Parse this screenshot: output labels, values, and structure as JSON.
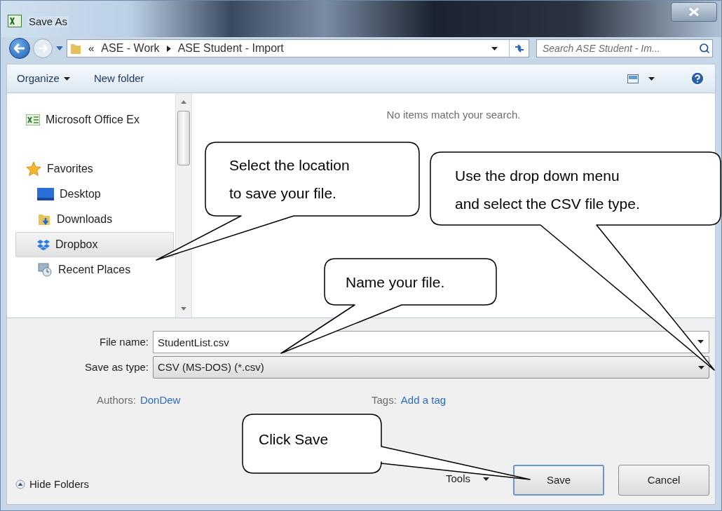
{
  "window": {
    "title": "Save As"
  },
  "address": {
    "overflow": "«",
    "breadcrumb": [
      "ASE - Work",
      "ASE Student - Import"
    ]
  },
  "search": {
    "placeholder": "Search ASE Student - Im..."
  },
  "toolbar": {
    "organize": "Organize",
    "new_folder": "New folder"
  },
  "nav": {
    "items": [
      {
        "label": "Microsoft Office Ex",
        "kind": "excel",
        "selected": false
      },
      {
        "label": "Favorites",
        "kind": "star",
        "selected": false
      },
      {
        "label": "Desktop",
        "kind": "desktop",
        "selected": false
      },
      {
        "label": "Downloads",
        "kind": "downloads",
        "selected": false
      },
      {
        "label": "Dropbox",
        "kind": "dropbox",
        "selected": true
      },
      {
        "label": "Recent Places",
        "kind": "recent",
        "selected": false
      }
    ]
  },
  "message": "No items match your search.",
  "fields": [
    {
      "label": "File name:",
      "value": "StudentList.csv",
      "kind": "text"
    },
    {
      "label": "Save as type:",
      "value": "CSV (MS-DOS) (*.csv)",
      "kind": "select"
    }
  ],
  "meta": [
    {
      "label": "Authors:",
      "value": "DonDew"
    },
    {
      "label": "Tags:",
      "value": "Add a tag"
    }
  ],
  "hide_folders": "Hide Folders",
  "tools": "Tools",
  "buttons": [
    {
      "label": "Save",
      "kind": "primary"
    },
    {
      "label": "Cancel",
      "kind": "normal"
    }
  ],
  "callouts": [
    {
      "text": "Select the location\nto save your file."
    },
    {
      "text": "Use the drop down menu\nand select the CSV file type."
    },
    {
      "text": "Name your file."
    },
    {
      "text": "Click Save"
    }
  ]
}
